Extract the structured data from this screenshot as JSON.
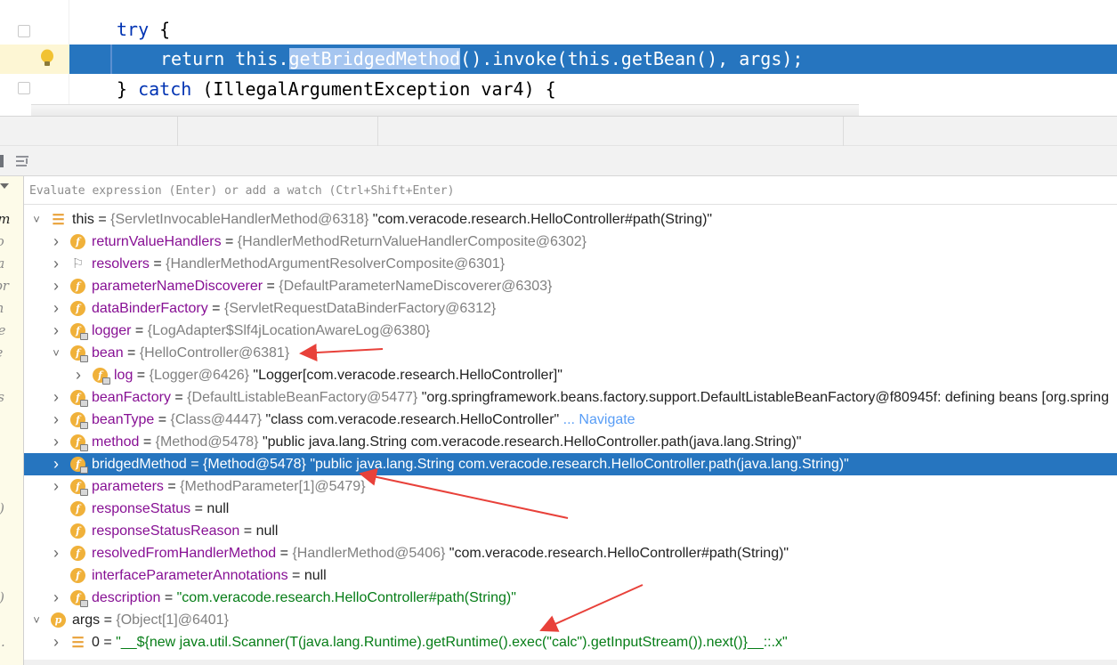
{
  "editor": {
    "lines": [
      {
        "indent": 1,
        "parts": [
          {
            "t": "try",
            "k": true
          },
          {
            "t": " {"
          }
        ]
      },
      {
        "indent": 2,
        "selected": true,
        "parts": [
          {
            "t": "return",
            "k": true
          },
          {
            "t": " this."
          },
          {
            "t": "getBridgedMethod",
            "hl": true
          },
          {
            "t": "().invoke(this.getBean(), args);"
          }
        ]
      },
      {
        "indent": 1,
        "parts": [
          {
            "t": "} "
          },
          {
            "t": "catch",
            "k": true
          },
          {
            "t": " (IllegalArgumentException var4) {"
          }
        ]
      }
    ]
  },
  "evaluate": {
    "placeholder": "Evaluate expression (Enter) or add a watch (Ctrl+Shift+Enter)"
  },
  "left_frames": [
    {
      "text": "eb.m",
      "dark": true
    },
    {
      "text": "ewo"
    },
    {
      "text": "gfra"
    },
    {
      "text": "v.spr"
    },
    {
      "text": "ram"
    },
    {
      "text": "t.we"
    },
    {
      "text": "rvle"
    },
    {
      "text": "et)"
    },
    {
      "text": "eb.s"
    },
    {
      "text": ""
    },
    {
      "text": ""
    },
    {
      "text": ""
    },
    {
      "text": ""
    },
    {
      "text": "ore)"
    },
    {
      "text": ""
    },
    {
      "text": ""
    },
    {
      "text": ""
    },
    {
      "text": "ore)"
    },
    {
      "text": ""
    },
    {
      "text": "veb."
    },
    {
      "text": ""
    }
  ],
  "variables": [
    {
      "depth": 0,
      "exp": "open",
      "icon": "arr",
      "name": "this",
      "local": true,
      "ref": "{ServletInvocableHandlerMethod@6318}",
      "val": " \"com.veracode.research.HelloController#path(String)\""
    },
    {
      "depth": 1,
      "exp": "closed",
      "icon": "f",
      "lock": false,
      "name": "returnValueHandlers",
      "ref": "{HandlerMethodReturnValueHandlerComposite@6302}"
    },
    {
      "depth": 1,
      "exp": "closed",
      "icon": "flag",
      "name": "resolvers",
      "ref": "{HandlerMethodArgumentResolverComposite@6301}"
    },
    {
      "depth": 1,
      "exp": "closed",
      "icon": "f",
      "name": "parameterNameDiscoverer",
      "ref": "{DefaultParameterNameDiscoverer@6303}"
    },
    {
      "depth": 1,
      "exp": "closed",
      "icon": "f",
      "name": "dataBinderFactory",
      "ref": "{ServletRequestDataBinderFactory@6312}"
    },
    {
      "depth": 1,
      "exp": "closed",
      "icon": "f",
      "lock": true,
      "name": "logger",
      "ref": "{LogAdapter$Slf4jLocationAwareLog@6380}"
    },
    {
      "depth": 1,
      "exp": "open",
      "icon": "f",
      "lock": true,
      "name": "bean",
      "ref": "{HelloController@6381}"
    },
    {
      "depth": 2,
      "exp": "closed",
      "icon": "f",
      "lock": true,
      "name": "log",
      "ref": "{Logger@6426}",
      "val": " \"Logger[com.veracode.research.HelloController]\""
    },
    {
      "depth": 1,
      "exp": "closed",
      "icon": "f",
      "lock": true,
      "name": "beanFactory",
      "ref": "{DefaultListableBeanFactory@5477}",
      "val": " \"org.springframework.beans.factory.support.DefaultListableBeanFactory@f80945f: defining beans [org.spring"
    },
    {
      "depth": 1,
      "exp": "closed",
      "icon": "f",
      "lock": true,
      "name": "beanType",
      "ref": "{Class@4447}",
      "val": " \"class com.veracode.research.HelloController\"",
      "link": " ... Navigate"
    },
    {
      "depth": 1,
      "exp": "closed",
      "icon": "f",
      "lock": true,
      "name": "method",
      "ref": "{Method@5478}",
      "val": " \"public java.lang.String com.veracode.research.HelloController.path(java.lang.String)\""
    },
    {
      "depth": 1,
      "exp": "closed",
      "icon": "f",
      "lock": true,
      "selected": true,
      "name": "bridgedMethod",
      "ref": "{Method@5478}",
      "val": " \"public java.lang.String com.veracode.research.HelloController.path(java.lang.String)\""
    },
    {
      "depth": 1,
      "exp": "closed",
      "icon": "f",
      "lock": true,
      "name": "parameters",
      "ref": "{MethodParameter[1]@5479}"
    },
    {
      "depth": 1,
      "exp": "none",
      "icon": "f",
      "name": "responseStatus",
      "plain": "null"
    },
    {
      "depth": 1,
      "exp": "none",
      "icon": "f",
      "name": "responseStatusReason",
      "plain": "null"
    },
    {
      "depth": 1,
      "exp": "closed",
      "icon": "f",
      "name": "resolvedFromHandlerMethod",
      "ref": "{HandlerMethod@5406}",
      "val": " \"com.veracode.research.HelloController#path(String)\""
    },
    {
      "depth": 1,
      "exp": "none",
      "icon": "f",
      "name": "interfaceParameterAnnotations",
      "plain": "null"
    },
    {
      "depth": 1,
      "exp": "closed",
      "icon": "f",
      "lock": true,
      "name": "description",
      "str": "\"com.veracode.research.HelloController#path(String)\""
    },
    {
      "depth": 0,
      "exp": "open",
      "icon": "p",
      "name": "args",
      "local": true,
      "ref": "{Object[1]@6401}"
    },
    {
      "depth": 1,
      "exp": "closed",
      "icon": "arr",
      "name": "0",
      "local": true,
      "str": "\"__${new java.util.Scanner(T(java.lang.Runtime).getRuntime().exec(\"calc\").getInputStream()).next()}__::.x\""
    }
  ],
  "colors": {
    "selection": "#2675bf",
    "arrow": "#e8413a"
  }
}
